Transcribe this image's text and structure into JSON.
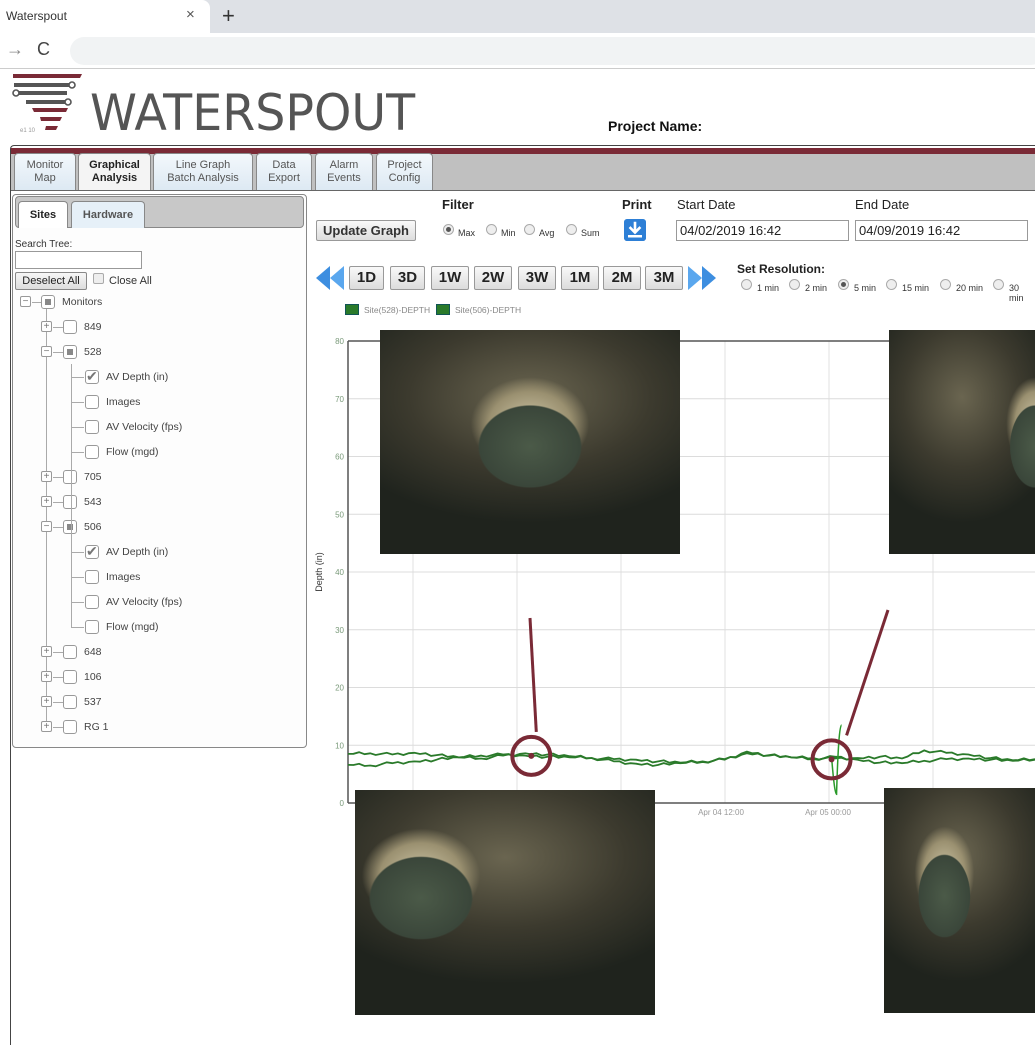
{
  "browser": {
    "tab_title": "Waterspout",
    "close_glyph": "×",
    "new_tab_glyph": "+",
    "forward_glyph": "→",
    "reload_glyph": "C"
  },
  "header": {
    "brand": "WATERSPOUT",
    "project_label": "Project Name:",
    "brand_colors": {
      "maroon": "#7a2a36",
      "gray": "#555555"
    }
  },
  "nav_tabs": [
    {
      "line1": "Monitor",
      "line2": "Map",
      "active": false
    },
    {
      "line1": "Graphical",
      "line2": "Analysis",
      "active": true
    },
    {
      "line1": "Line Graph",
      "line2": "Batch Analysis",
      "active": false
    },
    {
      "line1": "Data",
      "line2": "Export",
      "active": false
    },
    {
      "line1": "Alarm",
      "line2": "Events",
      "active": false
    },
    {
      "line1": "Project",
      "line2": "Config",
      "active": false
    }
  ],
  "sidebar": {
    "tabs": [
      "Sites",
      "Hardware"
    ],
    "search_label": "Search Tree:",
    "search_value": "",
    "deselect_label": "Deselect All",
    "close_all_label": "Close All",
    "tree": [
      {
        "label": "Monitors",
        "level": 0,
        "expander": "minus",
        "check": "partial"
      },
      {
        "label": "849",
        "level": 1,
        "expander": "plus",
        "check": "none"
      },
      {
        "label": "528",
        "level": 1,
        "expander": "minus",
        "check": "partial"
      },
      {
        "label": "AV Depth (in)",
        "level": 2,
        "expander": "",
        "check": "checked"
      },
      {
        "label": "Images",
        "level": 2,
        "expander": "",
        "check": "none"
      },
      {
        "label": "AV Velocity (fps)",
        "level": 2,
        "expander": "",
        "check": "none"
      },
      {
        "label": "Flow (mgd)",
        "level": 2,
        "expander": "",
        "check": "none"
      },
      {
        "label": "705",
        "level": 1,
        "expander": "plus",
        "check": "none"
      },
      {
        "label": "543",
        "level": 1,
        "expander": "plus",
        "check": "none"
      },
      {
        "label": "506",
        "level": 1,
        "expander": "minus",
        "check": "partial"
      },
      {
        "label": "AV Depth (in)",
        "level": 2,
        "expander": "",
        "check": "checked"
      },
      {
        "label": "Images",
        "level": 2,
        "expander": "",
        "check": "none"
      },
      {
        "label": "AV Velocity (fps)",
        "level": 2,
        "expander": "",
        "check": "none"
      },
      {
        "label": "Flow (mgd)",
        "level": 2,
        "expander": "",
        "check": "none"
      },
      {
        "label": "648",
        "level": 1,
        "expander": "plus",
        "check": "none"
      },
      {
        "label": "106",
        "level": 1,
        "expander": "plus",
        "check": "none"
      },
      {
        "label": "537",
        "level": 1,
        "expander": "plus",
        "check": "none"
      },
      {
        "label": "RG 1",
        "level": 1,
        "expander": "plus",
        "check": "none"
      }
    ]
  },
  "controls": {
    "update_label": "Update Graph",
    "filter_label": "Filter",
    "filter_options": [
      {
        "label": "Max",
        "selected": true
      },
      {
        "label": "Min",
        "selected": false
      },
      {
        "label": "Avg",
        "selected": false
      },
      {
        "label": "Sum",
        "selected": false
      }
    ],
    "print_label": "Print",
    "start_label": "Start Date",
    "start_value": "04/02/2019 16:42",
    "end_label": "End Date",
    "end_value": "04/09/2019 16:42",
    "ranges": [
      "1D",
      "3D",
      "1W",
      "2W",
      "3W",
      "1M",
      "2M",
      "3M"
    ],
    "resolution_label": "Set Resolution:",
    "resolutions": [
      {
        "label": "1 min",
        "selected": false
      },
      {
        "label": "2 min",
        "selected": false
      },
      {
        "label": "5 min",
        "selected": true
      },
      {
        "label": "15 min",
        "selected": false
      },
      {
        "label": "20 min",
        "selected": false
      },
      {
        "label": "30 min",
        "selected": false
      }
    ]
  },
  "chart_data": {
    "type": "line",
    "title": "",
    "xlabel": "",
    "ylabel": "Depth (in)",
    "ylim": [
      0,
      80
    ],
    "yticks": [
      0,
      10,
      20,
      30,
      40,
      50,
      60,
      70,
      80
    ],
    "x_tick_labels": [
      "Apr 04 12:00",
      "Apr 05 00:00"
    ],
    "grid": true,
    "legend_position": "top-left",
    "series": [
      {
        "name": "Site(528)-DEPTH",
        "color": "#2a7a2a",
        "values": [
          8.5,
          8.6,
          8.4,
          8.7,
          8.3,
          7.9,
          7.7,
          8.2,
          8.6,
          8.4,
          8.1,
          7.8,
          7.2,
          6.8,
          6.6,
          6.9,
          7.1,
          7.6,
          8.6,
          8.3,
          7.9,
          7.8,
          7.7,
          7.8,
          8.0,
          7.7,
          9.1,
          8.7,
          8.4,
          7.8,
          7.4,
          7.6
        ]
      },
      {
        "name": "Site(506)-DEPTH",
        "color": "#2a7a2a",
        "values": [
          6.6,
          6.5,
          6.9,
          7.2,
          7.5,
          7.9,
          8.2,
          8.4,
          8.2,
          8.0,
          7.9,
          7.8,
          7.6,
          7.5,
          7.2,
          7.0,
          7.2,
          7.5,
          8.9,
          8.2,
          7.9,
          7.6,
          8.0,
          7.5,
          7.0,
          6.9,
          7.3,
          7.6,
          7.7,
          7.5,
          7.3,
          7.5
        ]
      }
    ],
    "spike": {
      "index": 22,
      "min": 1.5,
      "max": 13.5
    },
    "annotations": [
      {
        "type": "circle-marker",
        "index": 8,
        "value": 8.5,
        "color": "#7a2a36"
      },
      {
        "type": "circle-marker",
        "index": 22,
        "value": 7.9,
        "color": "#7a2a36"
      }
    ]
  },
  "photos": [
    {
      "name": "pipe-photo-top-left"
    },
    {
      "name": "pipe-photo-top-right"
    },
    {
      "name": "pipe-photo-bottom-left"
    },
    {
      "name": "pipe-photo-bottom-right"
    }
  ]
}
